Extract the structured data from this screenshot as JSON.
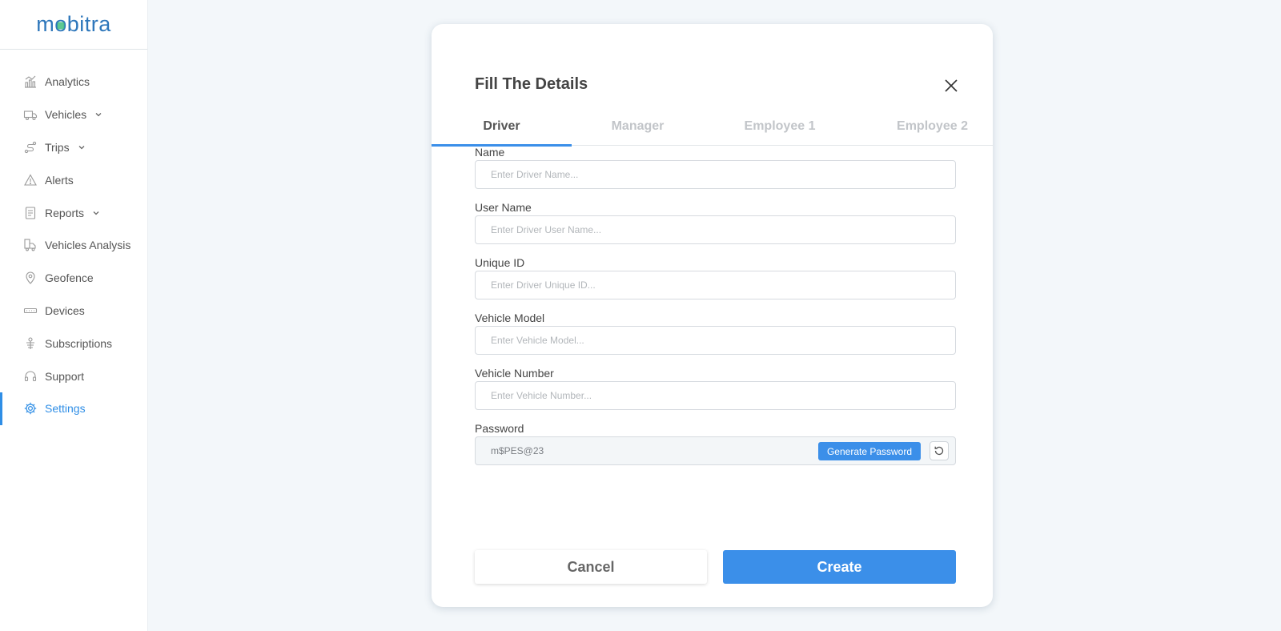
{
  "brand": {
    "name_a": "m",
    "name_o": "o",
    "name_b": "bitra"
  },
  "colors": {
    "accent": "#3b8fe9",
    "active_nav": "#2f8ee6",
    "logo": "#2e77bb",
    "logo_mark": "#3fbf7f"
  },
  "sidebar": {
    "items": [
      {
        "label": "Analytics",
        "icon": "analytics-icon",
        "has_chevron": false,
        "active": false
      },
      {
        "label": "Vehicles",
        "icon": "truck-icon",
        "has_chevron": true,
        "active": false
      },
      {
        "label": "Trips",
        "icon": "route-icon",
        "has_chevron": true,
        "active": false
      },
      {
        "label": "Alerts",
        "icon": "warning-icon",
        "has_chevron": false,
        "active": false
      },
      {
        "label": "Reports",
        "icon": "report-icon",
        "has_chevron": true,
        "active": false
      },
      {
        "label": "Vehicles Analysis",
        "icon": "vehicle-analysis-icon",
        "has_chevron": false,
        "active": false
      },
      {
        "label": "Geofence",
        "icon": "location-pin-icon",
        "has_chevron": false,
        "active": false
      },
      {
        "label": "Devices",
        "icon": "device-icon",
        "has_chevron": false,
        "active": false
      },
      {
        "label": "Subscriptions",
        "icon": "subscription-icon",
        "has_chevron": false,
        "active": false
      },
      {
        "label": "Support",
        "icon": "headset-icon",
        "has_chevron": false,
        "active": false
      },
      {
        "label": "Settings",
        "icon": "gear-icon",
        "has_chevron": false,
        "active": true
      }
    ]
  },
  "modal": {
    "title": "Fill The Details",
    "tabs": [
      {
        "label": "Driver",
        "active": true
      },
      {
        "label": "Manager",
        "active": false
      },
      {
        "label": "Employee 1",
        "active": false
      },
      {
        "label": "Employee 2",
        "active": false
      }
    ],
    "fields": {
      "name": {
        "label": "Name",
        "placeholder": "Enter Driver Name..."
      },
      "user_name": {
        "label": "User Name",
        "placeholder": "Enter Driver User Name..."
      },
      "unique_id": {
        "label": "Unique ID",
        "placeholder": "Enter Driver Unique ID..."
      },
      "vehicle_model": {
        "label": "Vehicle Model",
        "placeholder": "Enter Vehicle Model..."
      },
      "vehicle_number": {
        "label": "Vehicle Number",
        "placeholder": "Enter Vehicle Number..."
      }
    },
    "password": {
      "label": "Password",
      "value": "m$PES@23",
      "generate_label": "Generate Password"
    },
    "actions": {
      "cancel_label": "Cancel",
      "create_label": "Create"
    }
  }
}
